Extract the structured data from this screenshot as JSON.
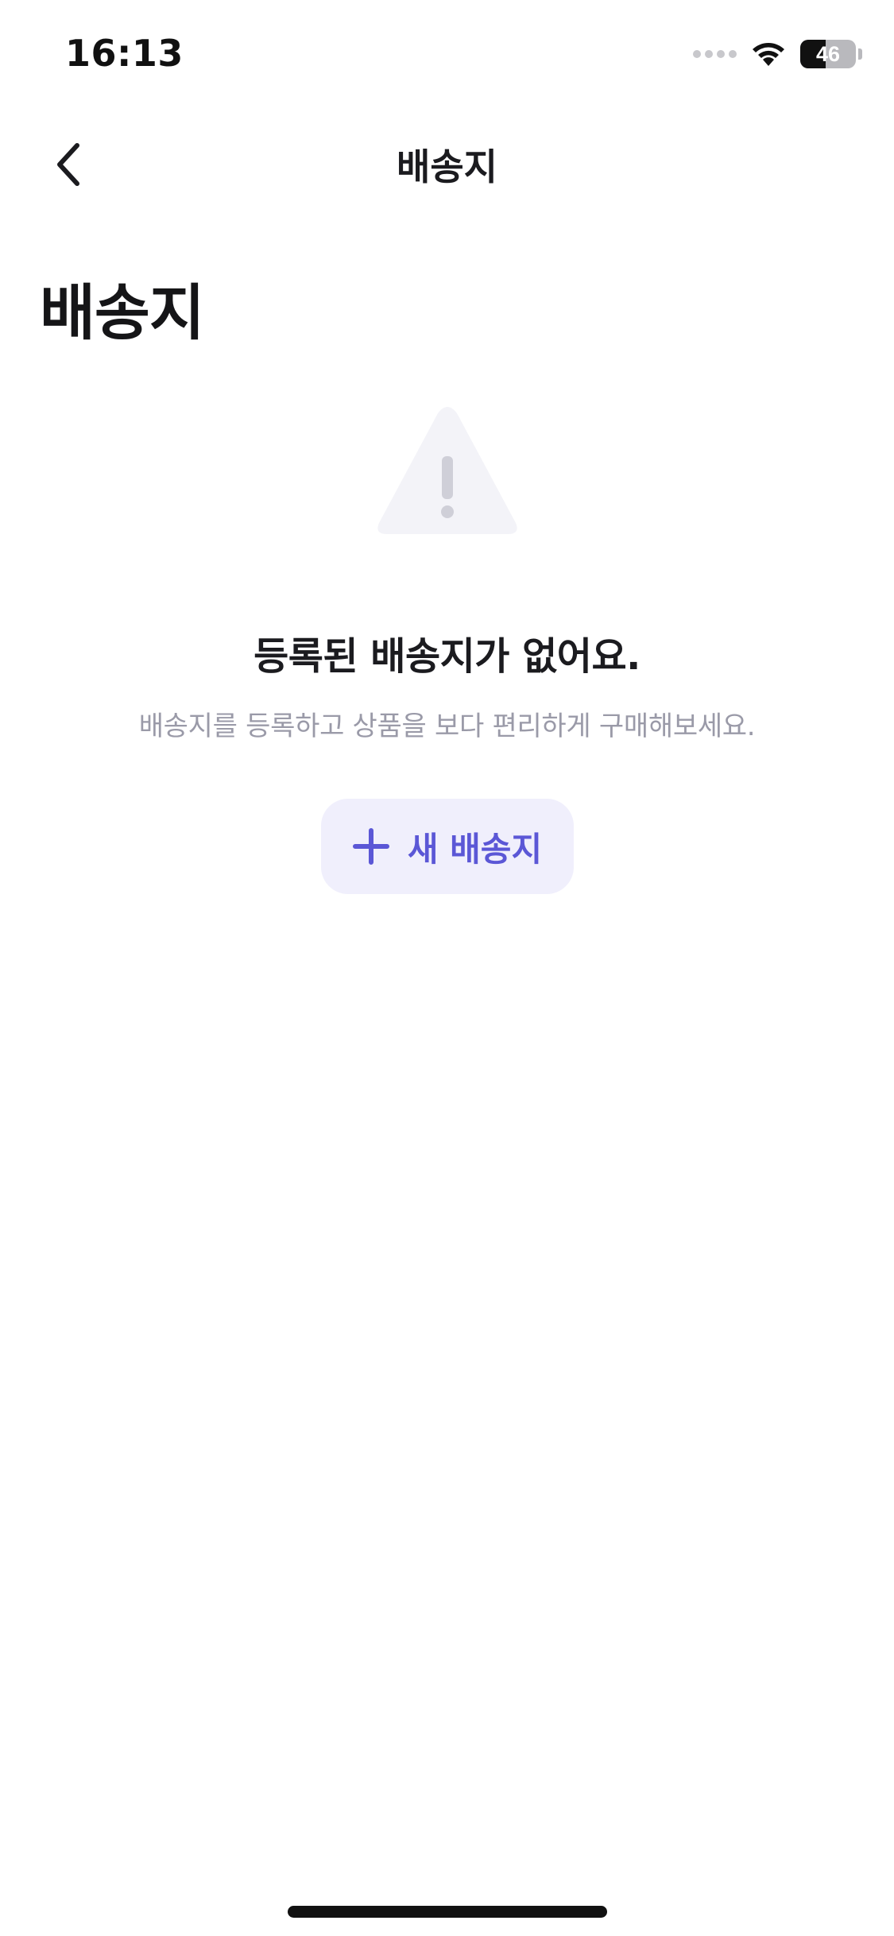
{
  "status_bar": {
    "time": "16:13",
    "battery_percent": "46",
    "icons": [
      "signal-dots-icon",
      "wifi-icon",
      "battery-icon"
    ]
  },
  "nav": {
    "title": "배송지",
    "back_icon": "chevron-left-icon"
  },
  "page": {
    "title": "배송지"
  },
  "empty_state": {
    "icon": "warning-triangle-icon",
    "heading": "등록된 배송지가 없어요.",
    "subtext": "배송지를 등록하고 상품을 보다 편리하게 구매해보세요.",
    "button_label": "새 배송지",
    "button_icon": "plus-icon"
  },
  "colors": {
    "accent": "#5b57d6",
    "button_bg": "#f0effc",
    "muted_text": "#9a9aa8",
    "icon_bg": "#f3f3f8",
    "icon_mark": "#cfcfd8"
  }
}
